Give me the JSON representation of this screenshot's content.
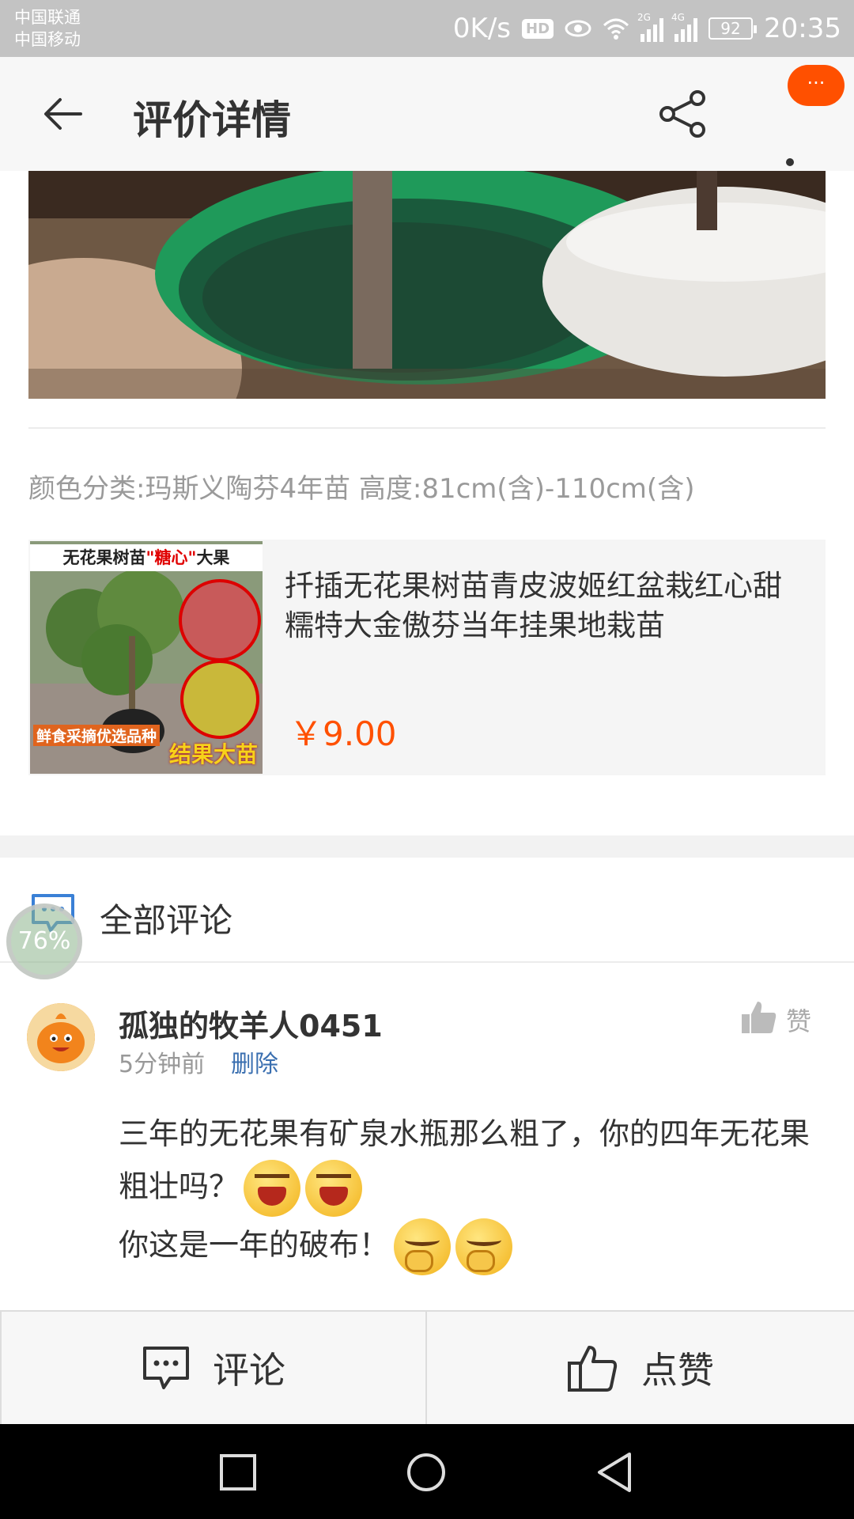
{
  "status_bar": {
    "carrier1": "中国联通",
    "carrier2": "中国移动",
    "speed": "0K/s",
    "hd": "HD",
    "net1": "2G",
    "net2": "4G",
    "battery": "92",
    "time": "20:35"
  },
  "header": {
    "title": "评价详情",
    "more_bubble": "···"
  },
  "review": {
    "sku": "颜色分类:玛斯义陶芬4年苗  高度:81cm(含)-110cm(含)"
  },
  "product": {
    "banner_prefix": "无花果树苗",
    "banner_highlight": "\"糖心\"",
    "banner_suffix": "大果",
    "tag_left": "鲜食采摘优选品种",
    "tag_right": "结果大苗",
    "name": "扦插无花果树苗青皮波姬红盆栽红心甜糯特大金傲芬当年挂果地栽苗",
    "price": "￥9.00"
  },
  "comments": {
    "section_title": "全部评论",
    "float_badge": "76%",
    "items": [
      {
        "username": "孤独的牧羊人0451",
        "time": "5分钟前",
        "delete_label": "删除",
        "like_label": "赞",
        "line1": "三年的无花果有矿泉水瓶那么粗了，你的四年无花果粗壮吗？",
        "line2": "你这是一年的破布！"
      }
    ]
  },
  "actions": {
    "comment_label": "评论",
    "like_label": "点赞"
  },
  "colors": {
    "accent": "#ff5000",
    "link": "#3a6fb0"
  }
}
